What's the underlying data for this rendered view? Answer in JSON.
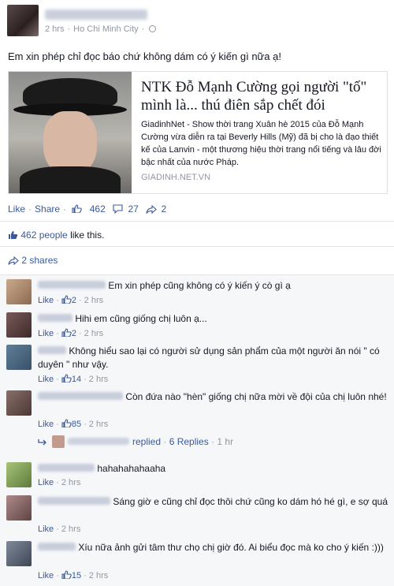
{
  "post": {
    "meta": {
      "time": "2 hrs",
      "location": "Ho Chi Minh City"
    },
    "status": "Em xin phép chỉ đọc báo chứ không dám có ý kiến gì nữa ạ!",
    "link": {
      "title": "NTK Đỗ Mạnh Cường gọi người \"tố\" mình là... thú điên sắp chết đói",
      "description": "GiadinhNet - Show thời trang Xuân hè 2015 của Đỗ Mạnh Cường vừa diễn ra tại Beverly Hills (Mỹ) đã bị cho là đạo thiết kế của Lanvin - một thương hiệu thời trang nổi tiếng và lâu đời bậc nhất của nước Pháp.",
      "domain": "GIADINH.NET.VN"
    },
    "actions": {
      "like": "Like",
      "share": "Share",
      "like_count": "462",
      "comment_count": "27",
      "share_count": "2"
    },
    "likes_summary": {
      "count_text": "462 people",
      "suffix": " like this."
    },
    "shares_summary": "2 shares"
  },
  "comments": [
    {
      "text": "Em xin phép cũng không có ý kiến ý cò gì ạ",
      "like": "Like",
      "likes": "2",
      "time": "2 hrs"
    },
    {
      "text": "Hihi em cũng giống chị luôn ạ...",
      "like": "Like",
      "likes": "2",
      "time": "2 hrs"
    },
    {
      "text": "Không hiểu sao lại có người sử dụng sản phẩm của một người ăn nói \" có duyên \" như vậy.",
      "like": "Like",
      "likes": "14",
      "time": "2 hrs"
    },
    {
      "text": "Còn đứa nào \"hèn\" giống chị nữa mời về đội của chị luôn nhé!",
      "like": "Like",
      "likes": "85",
      "time": "2 hrs"
    },
    {
      "text": "hahahahahaaha",
      "like": "Like",
      "time": "2 hrs"
    },
    {
      "text": "Sáng giờ e cũng chỉ đọc thôi chứ cũng ko dám hó hé gì, e sợ quá",
      "like": "Like",
      "time": "2 hrs"
    },
    {
      "text": "Xíu nữa ảnh gửi tâm thư chọ chị giờ đó. Ai biểu đọc mà ko cho ý kiến :)))",
      "like": "Like",
      "likes": "15",
      "time": "2 hrs"
    }
  ],
  "replies": {
    "label": "replied",
    "count": "6 Replies",
    "time": "1 hr"
  },
  "colors": {
    "link": "#3b5998",
    "muted": "#9197a3",
    "comments_bg": "#f6f7f9"
  }
}
